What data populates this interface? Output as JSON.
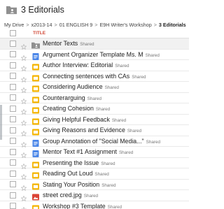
{
  "header": {
    "title": "3 Editorials",
    "icon": "shared-folder-icon"
  },
  "breadcrumb": {
    "items": [
      "My Drive",
      "x2013-14",
      "01 ENGLISH 9",
      "E9H Writer's Workshop",
      "3 Editorials"
    ],
    "separator": ">"
  },
  "list_header": {
    "title_label": "TITLE"
  },
  "shared_label": "Shared",
  "colors": {
    "doc_blue": "#4a86e8",
    "slides_yellow": "#f4b400",
    "image_red": "#db4437",
    "folder_gray": "#8f8f8f",
    "title_red": "#d14836"
  },
  "files": [
    {
      "name": "Mentor Texts",
      "type": "shared-folder",
      "shared": true
    },
    {
      "name": "Argument Organizer Template Ms. M",
      "type": "doc",
      "shared": true
    },
    {
      "name": "Author Interview: Editorial",
      "type": "slides",
      "shared": true
    },
    {
      "name": "Connecting sentences with CAs",
      "type": "slides",
      "shared": true
    },
    {
      "name": "Considering Audience",
      "type": "slides",
      "shared": true
    },
    {
      "name": "Counterarguing",
      "type": "slides",
      "shared": true
    },
    {
      "name": "Creating Cohesion",
      "type": "slides",
      "shared": true
    },
    {
      "name": "Giving Helpful Feedback",
      "type": "slides",
      "shared": true
    },
    {
      "name": "Giving Reasons and Evidence",
      "type": "slides",
      "shared": true
    },
    {
      "name": "Group Annotation of \"Social Media...\"",
      "type": "doc",
      "shared": true
    },
    {
      "name": "Mentor Text #1 Assignment",
      "type": "doc",
      "shared": true
    },
    {
      "name": "Presenting the Issue",
      "type": "slides",
      "shared": true
    },
    {
      "name": "Reading Out Loud",
      "type": "slides",
      "shared": true
    },
    {
      "name": "Stating Your Position",
      "type": "slides",
      "shared": true
    },
    {
      "name": "street cred.jpg",
      "type": "image",
      "shared": true
    },
    {
      "name": "Workshop #3 Template",
      "type": "slides",
      "shared": true
    }
  ]
}
